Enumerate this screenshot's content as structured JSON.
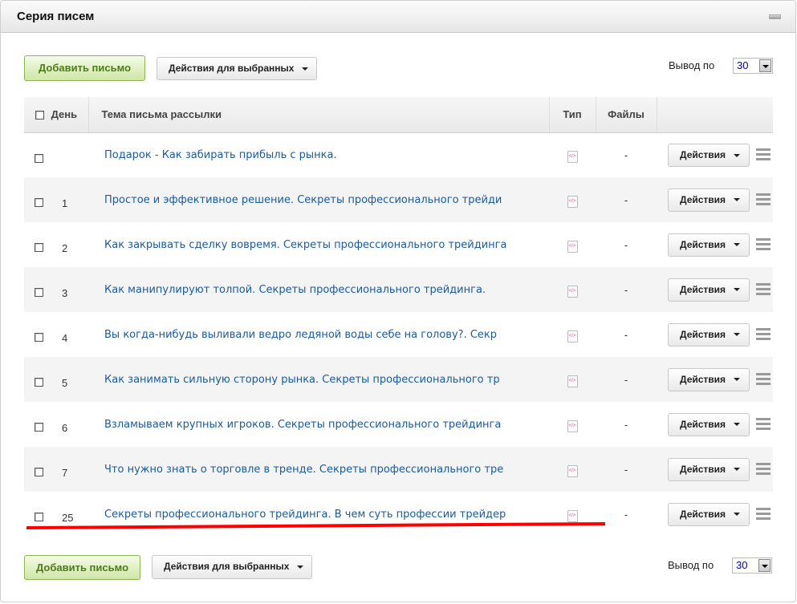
{
  "header": {
    "title": "Серия писем"
  },
  "toolbar": {
    "add_label": "Добавить письмо",
    "bulk_label": "Действия для выбранных",
    "per_page_label": "Вывод по",
    "per_page_value": "30"
  },
  "table": {
    "columns": {
      "day": "День",
      "topic": "Тема письма рассылки",
      "type": "Тип",
      "files": "Файлы"
    },
    "rows": [
      {
        "day": "",
        "topic": "Подарок - Как забирать прибыль с рынка.",
        "files": "-",
        "action": "Действия"
      },
      {
        "day": "1",
        "topic": "Простое и эффективное решение. Секреты профессионального трейди",
        "files": "-",
        "action": "Действия"
      },
      {
        "day": "2",
        "topic": "Как закрывать сделку вовремя. Секреты профессионального трейдинга",
        "files": "-",
        "action": "Действия"
      },
      {
        "day": "3",
        "topic": "Как манипулируют толпой. Секреты профессионального трейдинга.",
        "files": "-",
        "action": "Действия"
      },
      {
        "day": "4",
        "topic": "Вы когда-нибудь выливали ведро ледяной воды себе на голову?. Секр",
        "files": "-",
        "action": "Действия"
      },
      {
        "day": "5",
        "topic": "Как занимать сильную сторону рынка. Секреты профессионального тр",
        "files": "-",
        "action": "Действия"
      },
      {
        "day": "6",
        "topic": "Взламываем крупных игроков. Секреты профессионального трейдинга",
        "files": "-",
        "action": "Действия"
      },
      {
        "day": "7",
        "topic": "Что нужно знать о торговле в тренде. Секреты профессионального тре",
        "files": "-",
        "action": "Действия"
      },
      {
        "day": "25",
        "topic": "Секреты профессионального трейдинга. В чем суть профессии трейдер",
        "files": "-",
        "action": "Действия"
      }
    ]
  },
  "icons": {
    "type": "html-file-icon"
  },
  "colors": {
    "link": "#1a5a9e",
    "add_button": "#4f7a1b",
    "annotation": "#ff0000"
  }
}
